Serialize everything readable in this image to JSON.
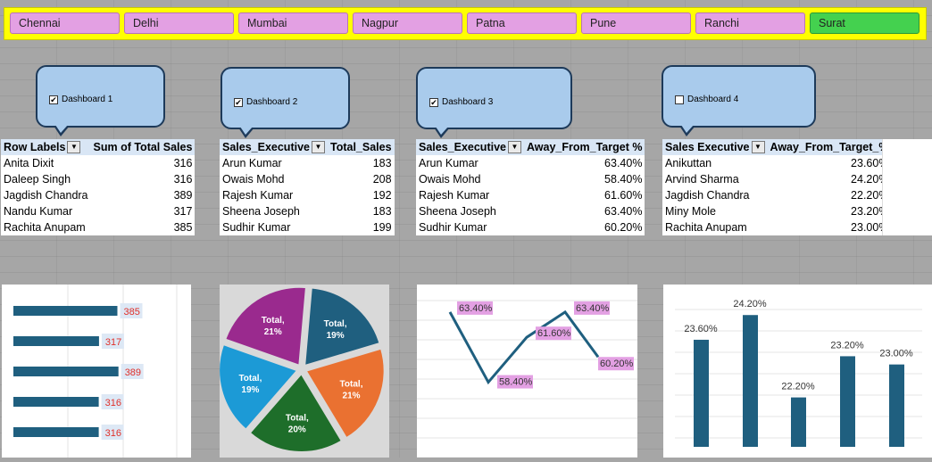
{
  "slicer": {
    "cities": [
      "Chennai",
      "Delhi",
      "Mumbai",
      "Nagpur",
      "Patna",
      "Pune",
      "Ranchi",
      "Surat"
    ],
    "selected": "Surat",
    "colors": {
      "normal": "#e3a0e3",
      "selected": "#44d14f",
      "bar": "#ffff00"
    }
  },
  "dashboards": [
    {
      "label": "Dashboard 1",
      "checked": true
    },
    {
      "label": "Dashboard 2",
      "checked": true
    },
    {
      "label": "Dashboard 3",
      "checked": true
    },
    {
      "label": "Dashboard 4",
      "checked": false
    }
  ],
  "tables": {
    "t1": {
      "headers": [
        "Row Labels",
        "Sum of Total Sales"
      ],
      "rows": [
        [
          "Anita Dixit",
          "316"
        ],
        [
          "Daleep Singh",
          "316"
        ],
        [
          "Jagdish Chandra",
          "389"
        ],
        [
          "Nandu Kumar",
          "317"
        ],
        [
          "Rachita Anupam",
          "385"
        ]
      ]
    },
    "t2": {
      "headers": [
        "Sales_Executive",
        "Total_Sales"
      ],
      "rows": [
        [
          "Arun Kumar",
          "183"
        ],
        [
          "Owais Mohd",
          "208"
        ],
        [
          "Rajesh Kumar",
          "192"
        ],
        [
          "Sheena Joseph",
          "183"
        ],
        [
          "Sudhir Kumar",
          "199"
        ]
      ]
    },
    "t3": {
      "headers": [
        "Sales_Executive",
        "Away_From_Target %"
      ],
      "rows": [
        [
          "Arun Kumar",
          "63.40%"
        ],
        [
          "Owais Mohd",
          "58.40%"
        ],
        [
          "Rajesh Kumar",
          "61.60%"
        ],
        [
          "Sheena Joseph",
          "63.40%"
        ],
        [
          "Sudhir Kumar",
          "60.20%"
        ]
      ]
    },
    "t4": {
      "headers": [
        "Sales Executive",
        "Away_From_Target_%"
      ],
      "rows": [
        [
          "Anikuttan",
          "23.60%"
        ],
        [
          "Arvind Sharma",
          "24.20%"
        ],
        [
          "Jagdish Chandra",
          "22.20%"
        ],
        [
          "Miny Mole",
          "23.20%"
        ],
        [
          "Rachita Anupam",
          "23.00%"
        ]
      ]
    }
  },
  "chart_data": [
    {
      "type": "bar",
      "orientation": "horizontal",
      "values": [
        385,
        317,
        389,
        316,
        316
      ],
      "data_labels": [
        "385",
        "317",
        "389",
        "316",
        "316"
      ],
      "color": "#1f5f7f",
      "label_color": "#e0302a"
    },
    {
      "type": "pie",
      "slices": [
        {
          "label": "Total,",
          "pct": "19%",
          "value": 19,
          "color": "#1f5f7f"
        },
        {
          "label": "Total,",
          "pct": "21%",
          "value": 21,
          "color": "#ea7131"
        },
        {
          "label": "Total,",
          "pct": "20%",
          "value": 20,
          "color": "#1e6e2a"
        },
        {
          "label": "Total,",
          "pct": "19%",
          "value": 19,
          "color": "#1c9ad6"
        },
        {
          "label": "Total,",
          "pct": "21%",
          "value": 21,
          "color": "#9a2a8e"
        }
      ]
    },
    {
      "type": "line",
      "values": [
        63.4,
        58.4,
        61.6,
        63.4,
        60.2
      ],
      "data_labels": [
        "63.40%",
        "58.40%",
        "61.60%",
        "63.40%",
        "60.20%"
      ],
      "color": "#1f5f7f",
      "label_bg": "#e3a0e3"
    },
    {
      "type": "bar",
      "values": [
        23.6,
        24.2,
        22.2,
        23.2,
        23.0
      ],
      "data_labels": [
        "23.60%",
        "24.20%",
        "22.20%",
        "23.20%",
        "23.00%"
      ],
      "color": "#1f5f7f"
    }
  ]
}
